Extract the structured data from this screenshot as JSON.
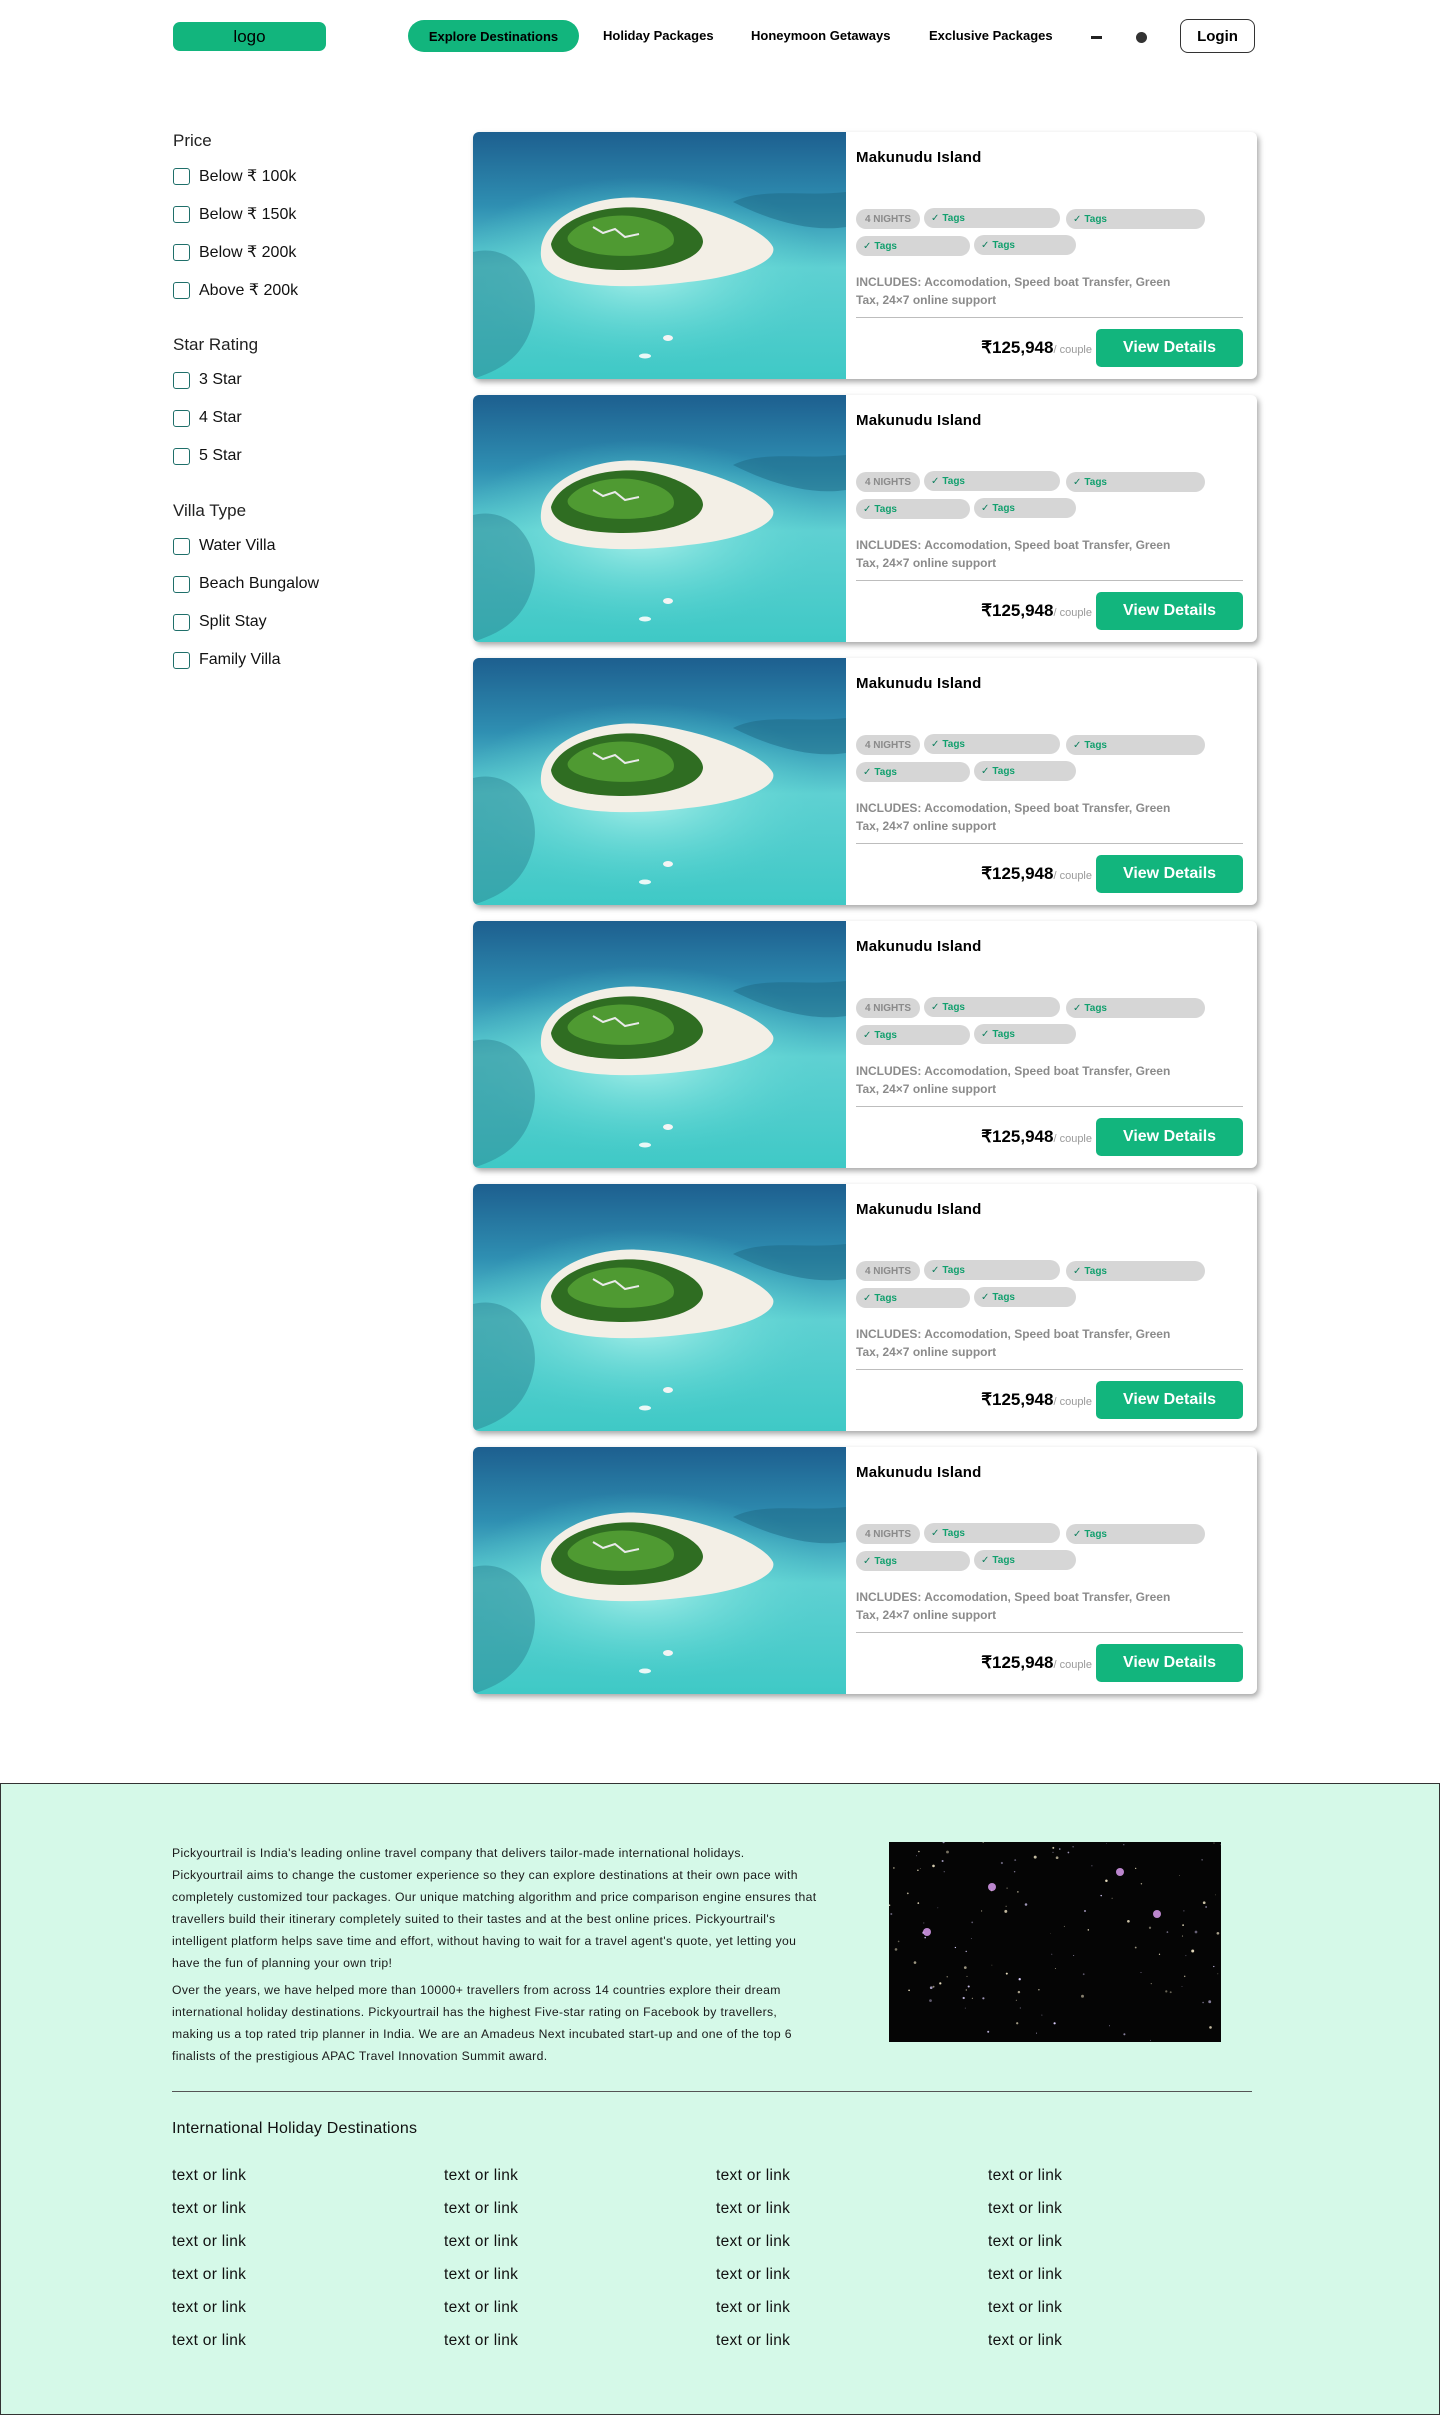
{
  "nav": {
    "logo": "logo",
    "links": [
      "Explore Destinations",
      "Holiday Packages",
      "Honeymoon Getaways",
      "Exclusive Packages"
    ],
    "login": "Login"
  },
  "filters": [
    {
      "heading": "Price",
      "options": [
        "Below ₹ 100k",
        "Below ₹ 150k",
        "Below ₹ 200k",
        "Above ₹ 200k"
      ]
    },
    {
      "heading": "Star Rating",
      "options": [
        "3 Star",
        "4 Star",
        "5 Star"
      ]
    },
    {
      "heading": "Villa Type",
      "options": [
        "Water Villa",
        "Beach Bungalow",
        "Split Stay",
        "Family Villa"
      ]
    }
  ],
  "cards": [
    {
      "title": "Makunudu Island",
      "nights": "4 NIGHTS",
      "tags": [
        "Tags",
        "Tags",
        "Tags",
        "Tags"
      ],
      "includes": "INCLUDES: Accomodation, Speed boat Transfer, Green Tax, 24×7 online support",
      "price": "₹125,948",
      "unit": "/ couple",
      "cta": "View Details"
    },
    {
      "title": "Makunudu Island",
      "nights": "4 NIGHTS",
      "tags": [
        "Tags",
        "Tags",
        "Tags",
        "Tags"
      ],
      "includes": "INCLUDES: Accomodation, Speed boat Transfer, Green Tax, 24×7 online support",
      "price": "₹125,948",
      "unit": "/ couple",
      "cta": "View Details"
    },
    {
      "title": "Makunudu Island",
      "nights": "4 NIGHTS",
      "tags": [
        "Tags",
        "Tags",
        "Tags",
        "Tags"
      ],
      "includes": "INCLUDES: Accomodation, Speed boat Transfer, Green Tax, 24×7 online support",
      "price": "₹125,948",
      "unit": "/ couple",
      "cta": "View Details"
    },
    {
      "title": "Makunudu Island",
      "nights": "4 NIGHTS",
      "tags": [
        "Tags",
        "Tags",
        "Tags",
        "Tags"
      ],
      "includes": "INCLUDES: Accomodation, Speed boat Transfer, Green Tax, 24×7 online support",
      "price": "₹125,948",
      "unit": "/ couple",
      "cta": "View Details"
    },
    {
      "title": "Makunudu Island",
      "nights": "4 NIGHTS",
      "tags": [
        "Tags",
        "Tags",
        "Tags",
        "Tags"
      ],
      "includes": "INCLUDES: Accomodation, Speed boat Transfer, Green Tax, 24×7 online support",
      "price": "₹125,948",
      "unit": "/ couple",
      "cta": "View Details"
    },
    {
      "title": "Makunudu Island",
      "nights": "4 NIGHTS",
      "tags": [
        "Tags",
        "Tags",
        "Tags",
        "Tags"
      ],
      "includes": "INCLUDES: Accomodation, Speed boat Transfer, Green Tax, 24×7 online support",
      "price": "₹125,948",
      "unit": "/ couple",
      "cta": "View Details"
    }
  ],
  "footer": {
    "about": [
      "Pickyourtrail is India's leading online travel company that delivers tailor-made international holidays. Pickyourtrail aims to change the customer experience so they can explore destinations at their own pace with completely customized tour packages. Our unique matching algorithm and price comparison engine ensures that travellers build their itinerary completely suited to their tastes and at the best online prices. Pickyourtrail's intelligent platform helps save time and effort, without having to wait for a travel agent's quote, yet letting you have the fun of planning your own trip!",
      "Over the years, we have helped more than 10000+ travellers from across 14 countries explore their dream international holiday destinations. Pickyourtrail has the highest Five-star rating on Facebook by travellers, making us a top rated trip planner in India. We are an Amadeus Next incubated start-up and one of the top 6 finalists of the prestigious APAC Travel Innovation Summit award."
    ],
    "heading": "International Holiday Destinations",
    "links": [
      [
        "text or link",
        "text or link",
        "text or link",
        "text or link",
        "text or link",
        "text or link"
      ],
      [
        "text or link",
        "text or link",
        "text or link",
        "text or link",
        "text or link",
        "text or link"
      ],
      [
        "text or link",
        "text or link",
        "text or link",
        "text or link",
        "text or link",
        "text or link"
      ],
      [
        "text or link",
        "text or link",
        "text or link",
        "text or link",
        "text or link",
        "text or link"
      ]
    ]
  },
  "colors": {
    "accent": "#12B57D",
    "footer_bg": "#D5F9E8",
    "chip_bg": "#D6D6D6",
    "muted_text": "#8B8B8B"
  },
  "icons": {
    "tag_check": "check-icon",
    "nav_extras": [
      "minus-icon",
      "dot-icon"
    ]
  }
}
